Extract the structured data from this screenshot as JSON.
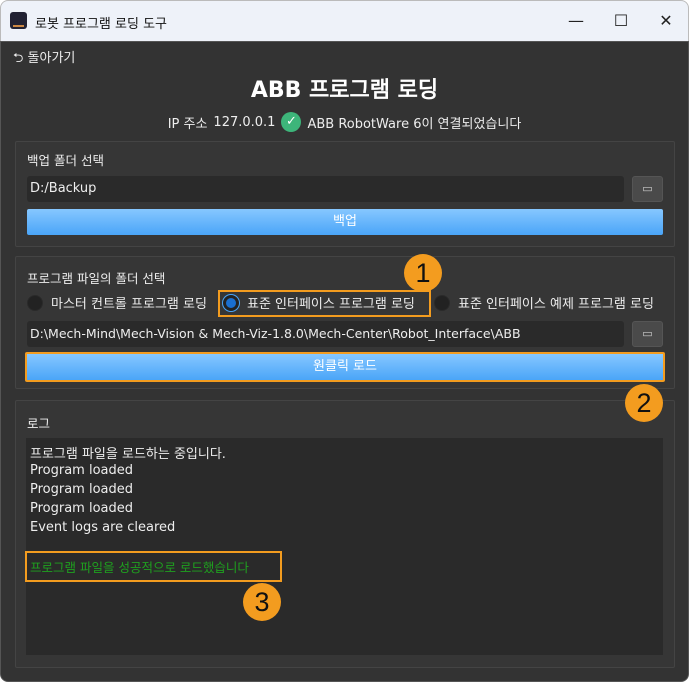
{
  "window": {
    "title": "로봇 프로그램 로딩 도구",
    "minimize": "—",
    "maximize": "☐",
    "close": "✕"
  },
  "back_label": "⮌ 돌아가기",
  "page_title": "ABB 프로그램 로딩",
  "connection": {
    "ip_label": "IP 주소",
    "ip": "127.0.0.1",
    "status": "ABB RobotWare 6이 연결되었습니다",
    "status_color": "#3db57a"
  },
  "backup": {
    "label": "백업 폴더 선택",
    "path": "D:/Backup",
    "button": "백업"
  },
  "program": {
    "label": "프로그램 파일의 폴더 선택",
    "options": [
      "마스터 컨트롤 프로그램 로딩",
      "표준 인터페이스 프로그램 로딩",
      "표준 인터페이스 예제 프로그램 로딩"
    ],
    "selected": 1,
    "path": "D:\\Mech-Mind\\Mech-Vision & Mech-Viz-1.8.0\\Mech-Center\\Robot_Interface\\ABB",
    "button": "원클릭 로드"
  },
  "log": {
    "label": "로그",
    "lines": [
      "프로그램 파일을 로드하는 중입니다.",
      "Program loaded",
      "Program loaded",
      "Program loaded",
      "Event logs are cleared"
    ],
    "success": "프로그램 파일을 성공적으로 로드했습니다",
    "success_color": "#1fa01f"
  },
  "badges": [
    "1",
    "2",
    "3"
  ],
  "folder_icon": "▭",
  "check_icon": "✓"
}
